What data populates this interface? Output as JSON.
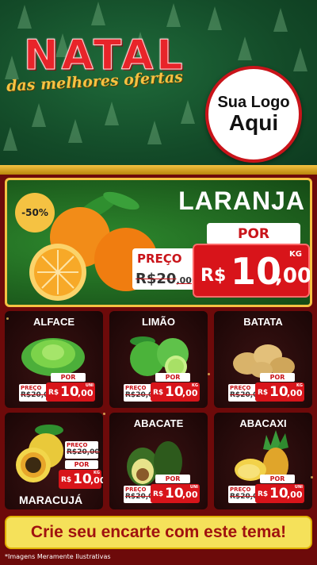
{
  "header": {
    "title": "NATAL",
    "subtitle": "das melhores ofertas",
    "logo_line1": "Sua Logo",
    "logo_line2": "Aqui"
  },
  "featured": {
    "discount_badge": "-50%",
    "name": "LARANJA",
    "por_label": "POR",
    "preco_label": "PREÇO",
    "old_price_int": "R$20",
    "old_price_dec": ",00",
    "currency": "R$",
    "price_int": "10",
    "price_dec": ",00",
    "unit": "KG"
  },
  "products": [
    {
      "name": "ALFACE",
      "preco_label": "PREÇO",
      "old_price": "R$20,00",
      "por_label": "POR",
      "currency": "R$",
      "price_int": "10",
      "price_dec": ",00",
      "unit": "UNI"
    },
    {
      "name": "LIMÃO",
      "preco_label": "PREÇO",
      "old_price": "R$20,00",
      "por_label": "POR",
      "currency": "R$",
      "price_int": "10",
      "price_dec": ",00",
      "unit": "KG"
    },
    {
      "name": "BATATA",
      "preco_label": "PREÇO",
      "old_price": "R$20,00",
      "por_label": "POR",
      "currency": "R$",
      "price_int": "10",
      "price_dec": ",00",
      "unit": "KG"
    },
    {
      "name": "MARACUJÁ",
      "preco_label": "PREÇO",
      "old_price": "R$20,00",
      "por_label": "POR",
      "currency": "R$",
      "price_int": "10",
      "price_dec": ",00",
      "unit": "KG"
    },
    {
      "name": "ABACATE",
      "preco_label": "PREÇO",
      "old_price": "R$20,00",
      "por_label": "POR",
      "currency": "R$",
      "price_int": "10",
      "price_dec": ",00",
      "unit": "UNI"
    },
    {
      "name": "ABACAXI",
      "preco_label": "PREÇO",
      "old_price": "R$20,00",
      "por_label": "POR",
      "currency": "R$",
      "price_int": "10",
      "price_dec": ",00",
      "unit": "UNI"
    }
  ],
  "cta": "Crie seu encarte com este tema!",
  "footnote": "*Imagens Meramente Ilustrativas",
  "colors": {
    "red": "#d8141a",
    "gold": "#f5c242",
    "green": "#1d5e1d"
  }
}
